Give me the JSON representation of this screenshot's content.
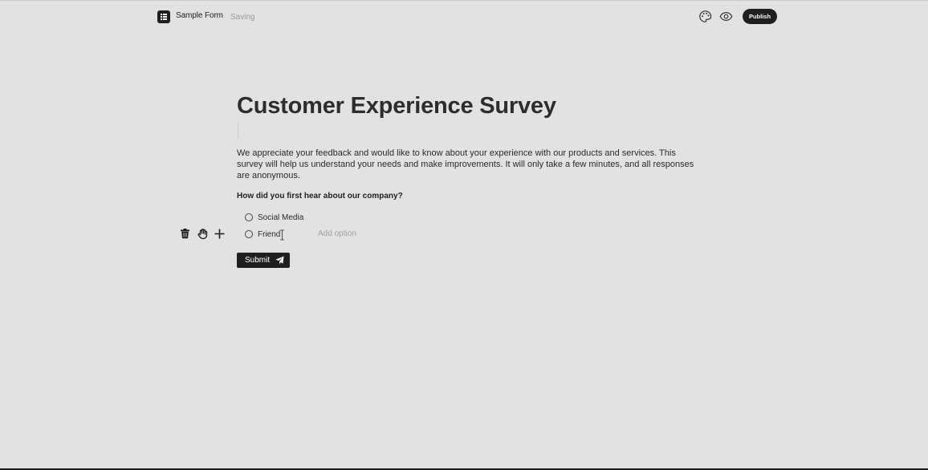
{
  "header": {
    "form_name": "Sample Form",
    "save_status": "Saving",
    "publish_label": "Publish",
    "icons": [
      "list-icon",
      "palette-icon",
      "eye-icon"
    ]
  },
  "form": {
    "title": "Customer Experience Survey",
    "description": "We appreciate your feedback and would like to know about your experience with our products and services. This survey will help us understand your needs and make improvements. It will only take a few minutes, and all responses are anonymous.",
    "question": {
      "label": "How did you first hear about our company?",
      "options": [
        "Social Media",
        "Friend"
      ],
      "add_option_placeholder": "Add option"
    },
    "block_tools": [
      "trash-icon",
      "drag-hand-icon",
      "plus-icon"
    ],
    "submit_label": "Submit"
  },
  "colors": {
    "background": "#e2e2e2",
    "accent_dark": "#1f1f1f",
    "muted_text": "#9a9a9a"
  }
}
